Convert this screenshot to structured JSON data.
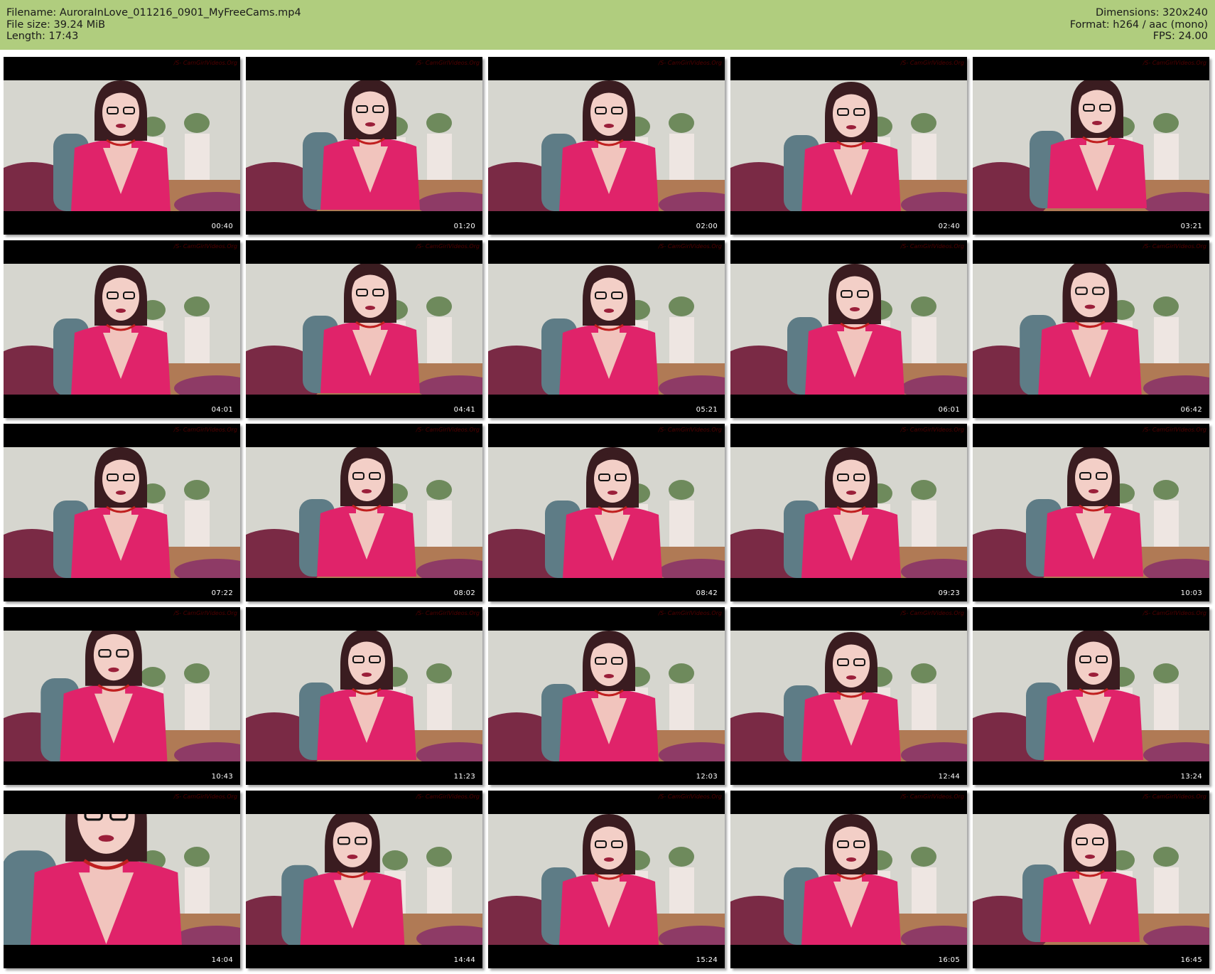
{
  "header": {
    "left": [
      "Filename: AuroraInLove_011216_0901_MyFreeCams.mp4",
      "File size: 39.24 MiB",
      "Length: 17:43"
    ],
    "right": [
      "Dimensions: 320x240",
      "Format: h264 / aac (mono)",
      "FPS: 24.00"
    ]
  },
  "watermark": "/S- CamGirlVideos.Org",
  "colors": {
    "header_bg": "#b0cd7e",
    "dress": "#e0236a",
    "hair": "#3a1c20",
    "wall": "#d6d6cf",
    "sofa": "#7a2a45",
    "chair": "#5e7c86"
  },
  "thumbnails": [
    {
      "time": "00:40"
    },
    {
      "time": "01:20"
    },
    {
      "time": "02:00"
    },
    {
      "time": "02:40"
    },
    {
      "time": "03:21"
    },
    {
      "time": "04:01"
    },
    {
      "time": "04:41"
    },
    {
      "time": "05:21"
    },
    {
      "time": "06:01"
    },
    {
      "time": "06:42"
    },
    {
      "time": "07:22"
    },
    {
      "time": "08:02"
    },
    {
      "time": "08:42"
    },
    {
      "time": "09:23"
    },
    {
      "time": "10:03"
    },
    {
      "time": "10:43"
    },
    {
      "time": "11:23"
    },
    {
      "time": "12:03"
    },
    {
      "time": "12:44"
    },
    {
      "time": "13:24"
    },
    {
      "time": "14:04"
    },
    {
      "time": "14:44"
    },
    {
      "time": "15:24"
    },
    {
      "time": "16:05"
    },
    {
      "time": "16:45"
    }
  ]
}
